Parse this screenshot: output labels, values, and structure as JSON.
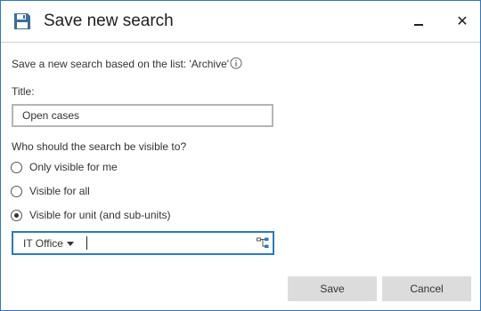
{
  "dialog": {
    "title": "Save new search",
    "icon": "floppy-disk-icon",
    "minimize_icon": "minimize-icon",
    "close_glyph": "✕"
  },
  "description": "Save a new search based on the list: 'Archive'",
  "title_field": {
    "label": "Title:",
    "value": "Open cases"
  },
  "visibility": {
    "question": "Who should the search be visible to?",
    "options": [
      {
        "label": "Only visible for me",
        "checked": false
      },
      {
        "label": "Visible for all",
        "checked": false
      },
      {
        "label": "Visible for unit (and sub-units)",
        "checked": true
      }
    ]
  },
  "unit_field": {
    "selected": "IT Office",
    "value": ""
  },
  "buttons": {
    "save": "Save",
    "cancel": "Cancel"
  },
  "colors": {
    "accent": "#2b79c2",
    "button_bg": "#dcdcdc",
    "border": "#b5b5b5"
  }
}
